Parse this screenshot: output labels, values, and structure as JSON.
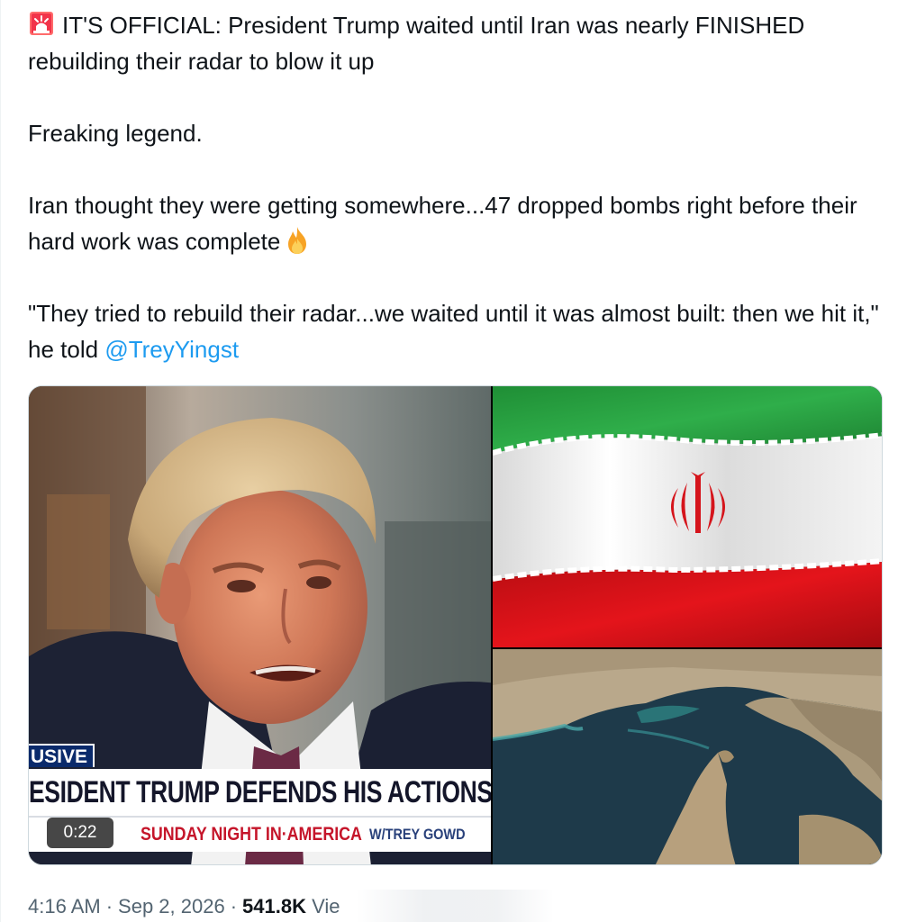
{
  "tweet": {
    "siren_icon": "police-siren-icon",
    "line1": "IT'S OFFICIAL: President Trump waited until Iran was nearly FINISHED rebuilding their radar to blow it up",
    "line2": "Freaking legend.",
    "line3": "Iran thought they were getting somewhere...47 dropped bombs right before their hard work was complete",
    "fire_icon": "fire-icon",
    "line4_prefix": "\"They tried to rebuild their radar...we waited until it was almost built: then we hit it,\" he told",
    "mention": "@TreyYingst"
  },
  "media": {
    "video": {
      "chyron_tag": "USIVE",
      "chyron_headline": "ESIDENT TRUMP DEFENDS HIS ACTIONS A",
      "chyron_show": "SUNDAY NIGHT IN·AMERICA",
      "chyron_host": "W/TREY GOWD",
      "duration": "0:22"
    },
    "flag_icon": "iran-flag-icon",
    "map_icon": "satellite-map-icon"
  },
  "meta": {
    "time": "4:16 AM",
    "separator": "·",
    "date": "Sep 2, 2026",
    "views_count": "541.8K",
    "views_label": "Vie"
  },
  "colors": {
    "text": "#0f1419",
    "muted": "#536471",
    "link": "#1d9bf0",
    "flag_green": "#239f40",
    "flag_red": "#da0000"
  }
}
